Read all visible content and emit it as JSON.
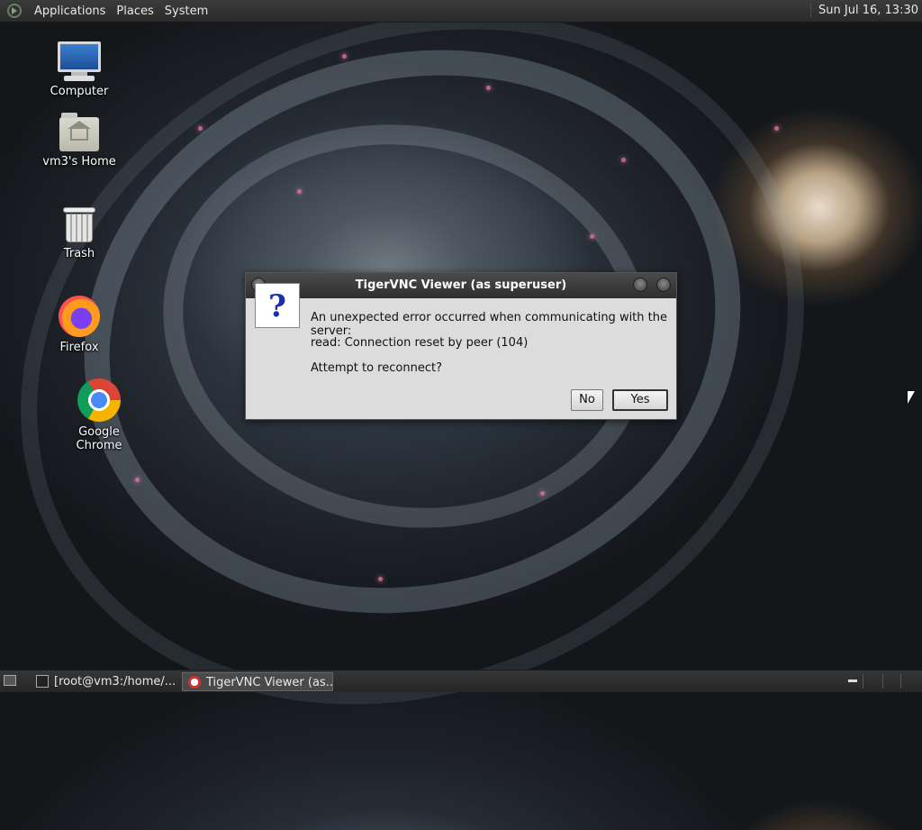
{
  "top_panel": {
    "menus": [
      "Applications",
      "Places",
      "System"
    ],
    "clock": "Sun Jul 16, 13:30"
  },
  "desktop_icons": [
    {
      "label": "Computer",
      "icon": "computer-icon"
    },
    {
      "label": "vm3's Home",
      "icon": "home-folder-icon"
    },
    {
      "label": "Trash",
      "icon": "trash-icon"
    },
    {
      "label": "Firefox",
      "icon": "firefox-icon"
    },
    {
      "label": "Google Chrome",
      "icon": "chrome-icon"
    }
  ],
  "dialog": {
    "title": "TigerVNC Viewer (as superuser)",
    "icon": "question-icon",
    "icon_glyph": "?",
    "message_line1": "An unexpected error occurred when communicating with the server:",
    "message_line2": "read: Connection reset by peer (104)",
    "message_line3": "Attempt to reconnect?",
    "no_label": "No",
    "yes_label": "Yes"
  },
  "bottom_panel": {
    "tasks": [
      {
        "label": "[root@vm3:/home/...",
        "icon": "terminal-icon"
      },
      {
        "label": "TigerVNC Viewer (as...",
        "icon": "tigervnc-icon"
      }
    ]
  },
  "colors": {
    "panel_bg": "#2f2f2f",
    "dialog_bg": "#dcdcdc",
    "question_mark": "#1a2fb0"
  }
}
